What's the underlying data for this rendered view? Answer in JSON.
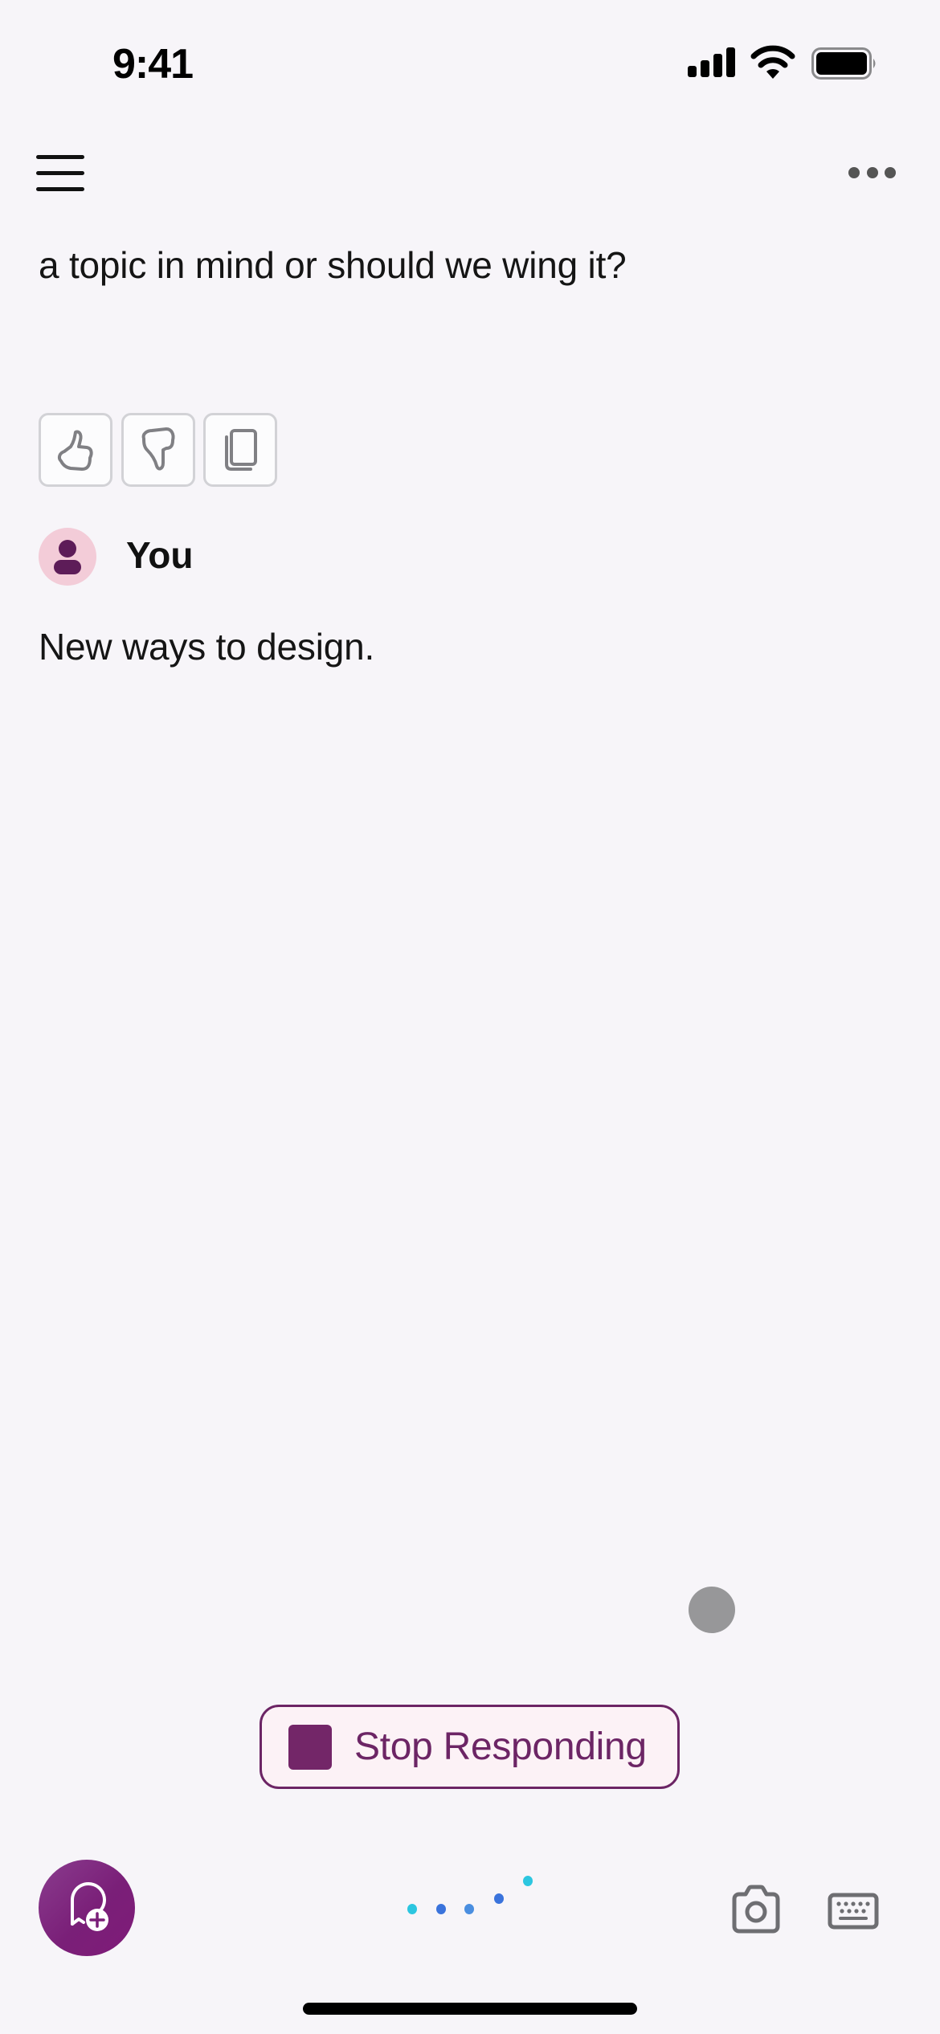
{
  "status_bar": {
    "time": "9:41",
    "icons": [
      "cellular-signal-icon",
      "wifi-icon",
      "battery-icon"
    ]
  },
  "nav": {
    "menu_icon": "hamburger-menu-icon",
    "more_icon": "more-horizontal-icon"
  },
  "conversation": {
    "assistant_partial_text": "a topic in mind or should we wing it?",
    "assistant_actions": [
      {
        "name": "thumbs-up",
        "icon": "thumbs-up-icon"
      },
      {
        "name": "thumbs-down",
        "icon": "thumbs-down-icon"
      },
      {
        "name": "copy",
        "icon": "copy-icon"
      }
    ],
    "user": {
      "name": "You",
      "avatar_icon": "person-icon",
      "message": "New ways to design."
    }
  },
  "stop_button": {
    "label": "Stop Responding",
    "icon": "stop-square-icon"
  },
  "bottom_bar": {
    "new_chat_icon": "new-chat-plus-icon",
    "voice_indicator": "voice-listening-dots",
    "camera_icon": "camera-icon",
    "keyboard_icon": "keyboard-icon"
  },
  "colors": {
    "background": "#f7f5f9",
    "accent": "#732668",
    "avatar_bg": "#f3ccd8",
    "voice_cyan": "#2cc6e0",
    "voice_blue": "#3a78e0"
  }
}
